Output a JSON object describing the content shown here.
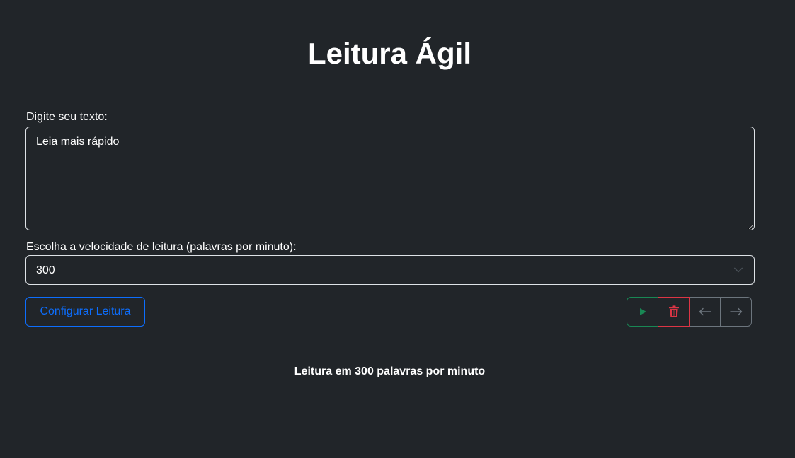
{
  "header": {
    "title": "Leitura Ágil"
  },
  "form": {
    "text_label": "Digite seu texto:",
    "text_value": "Leia mais rápido",
    "speed_label": "Escolha a velocidade de leitura (palavras por minuto):",
    "speed_selected": "300",
    "configure_button": "Configurar Leitura"
  },
  "controls": {
    "play_icon": "play-icon",
    "delete_icon": "trash-icon",
    "previous_icon": "arrow-left-icon",
    "next_icon": "arrow-right-icon"
  },
  "status": {
    "text": "Leitura em 300 palavras por minuto"
  },
  "colors": {
    "background": "#212529",
    "primary": "#0d6efd",
    "success": "#198754",
    "danger": "#dc3545",
    "secondary": "#6c757d",
    "border": "#dee2e6"
  }
}
